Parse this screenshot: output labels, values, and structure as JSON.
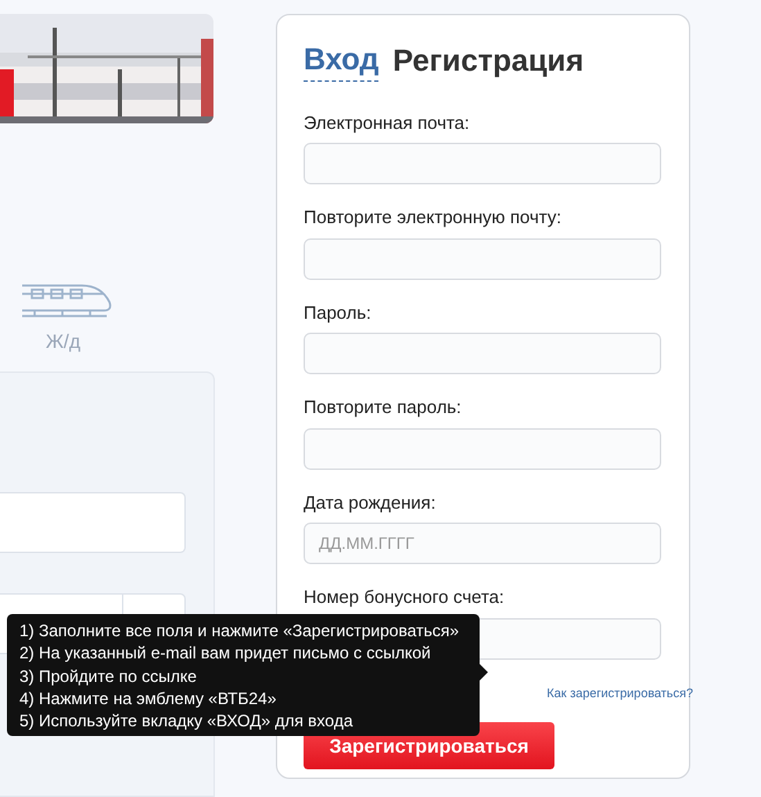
{
  "side": {
    "transport_label": "Ж/д"
  },
  "tabs": [
    {
      "label": "Вход",
      "selected": false
    },
    {
      "label": "Регистрация",
      "selected": true
    }
  ],
  "fields": [
    {
      "label": "Электронная почта:"
    },
    {
      "label": "Повторите электронную почту:"
    },
    {
      "label": "Пароль:"
    },
    {
      "label": "Повторите пароль:"
    },
    {
      "label": "Дата рождения:",
      "placeholder": "ДД.ММ.ГГГГ"
    },
    {
      "label": "Номер бонусного счета:"
    }
  ],
  "help_link": "Как зарегистрироваться?",
  "submit": "Зарегистрироваться",
  "tooltip": [
    "1) Заполните все поля и нажмите «Зарегистрироваться»",
    "2) На указанный e-mail вам придет письмо с ссылкой",
    "3) Пройдите по ссылке",
    "4) Нажмите на эмблему «ВТБ24»",
    "5) Используйте вкладку «ВХОД» для входа"
  ]
}
